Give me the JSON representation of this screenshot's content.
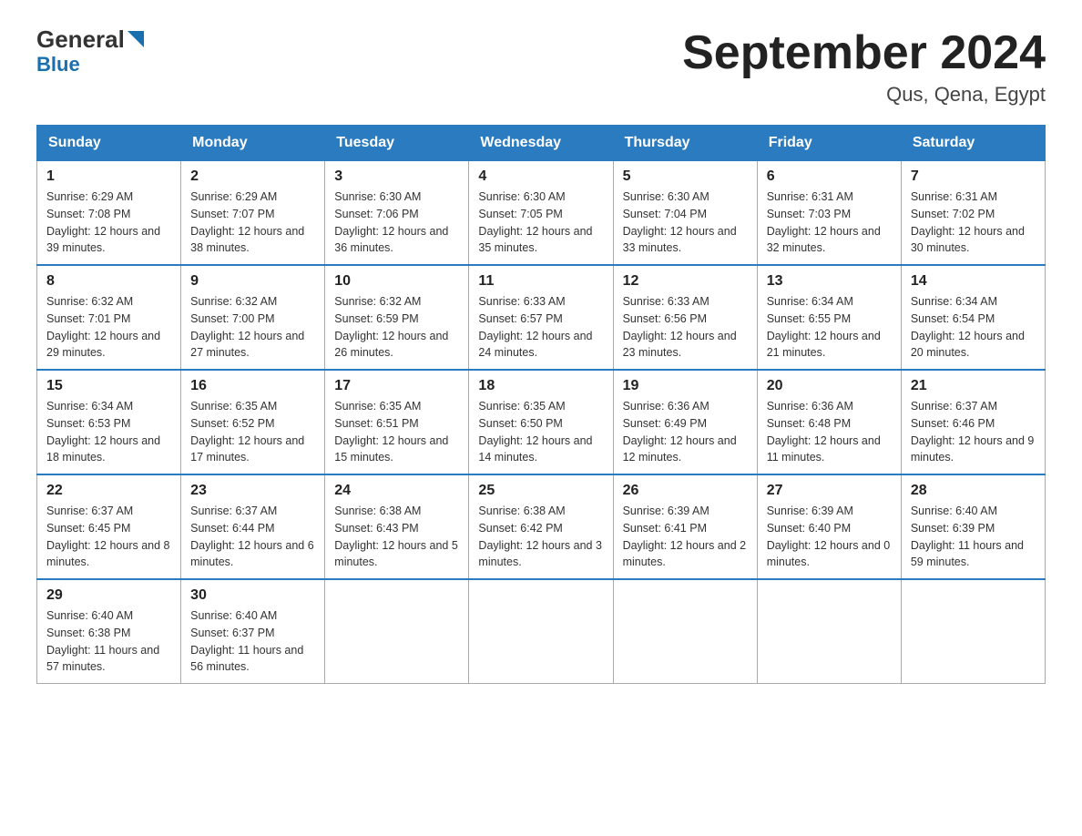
{
  "logo": {
    "text_general": "General",
    "text_blue": "Blue"
  },
  "title": "September 2024",
  "subtitle": "Qus, Qena, Egypt",
  "days_of_week": [
    "Sunday",
    "Monday",
    "Tuesday",
    "Wednesday",
    "Thursday",
    "Friday",
    "Saturday"
  ],
  "weeks": [
    [
      {
        "day": "1",
        "sunrise": "6:29 AM",
        "sunset": "7:08 PM",
        "daylight": "12 hours and 39 minutes."
      },
      {
        "day": "2",
        "sunrise": "6:29 AM",
        "sunset": "7:07 PM",
        "daylight": "12 hours and 38 minutes."
      },
      {
        "day": "3",
        "sunrise": "6:30 AM",
        "sunset": "7:06 PM",
        "daylight": "12 hours and 36 minutes."
      },
      {
        "day": "4",
        "sunrise": "6:30 AM",
        "sunset": "7:05 PM",
        "daylight": "12 hours and 35 minutes."
      },
      {
        "day": "5",
        "sunrise": "6:30 AM",
        "sunset": "7:04 PM",
        "daylight": "12 hours and 33 minutes."
      },
      {
        "day": "6",
        "sunrise": "6:31 AM",
        "sunset": "7:03 PM",
        "daylight": "12 hours and 32 minutes."
      },
      {
        "day": "7",
        "sunrise": "6:31 AM",
        "sunset": "7:02 PM",
        "daylight": "12 hours and 30 minutes."
      }
    ],
    [
      {
        "day": "8",
        "sunrise": "6:32 AM",
        "sunset": "7:01 PM",
        "daylight": "12 hours and 29 minutes."
      },
      {
        "day": "9",
        "sunrise": "6:32 AM",
        "sunset": "7:00 PM",
        "daylight": "12 hours and 27 minutes."
      },
      {
        "day": "10",
        "sunrise": "6:32 AM",
        "sunset": "6:59 PM",
        "daylight": "12 hours and 26 minutes."
      },
      {
        "day": "11",
        "sunrise": "6:33 AM",
        "sunset": "6:57 PM",
        "daylight": "12 hours and 24 minutes."
      },
      {
        "day": "12",
        "sunrise": "6:33 AM",
        "sunset": "6:56 PM",
        "daylight": "12 hours and 23 minutes."
      },
      {
        "day": "13",
        "sunrise": "6:34 AM",
        "sunset": "6:55 PM",
        "daylight": "12 hours and 21 minutes."
      },
      {
        "day": "14",
        "sunrise": "6:34 AM",
        "sunset": "6:54 PM",
        "daylight": "12 hours and 20 minutes."
      }
    ],
    [
      {
        "day": "15",
        "sunrise": "6:34 AM",
        "sunset": "6:53 PM",
        "daylight": "12 hours and 18 minutes."
      },
      {
        "day": "16",
        "sunrise": "6:35 AM",
        "sunset": "6:52 PM",
        "daylight": "12 hours and 17 minutes."
      },
      {
        "day": "17",
        "sunrise": "6:35 AM",
        "sunset": "6:51 PM",
        "daylight": "12 hours and 15 minutes."
      },
      {
        "day": "18",
        "sunrise": "6:35 AM",
        "sunset": "6:50 PM",
        "daylight": "12 hours and 14 minutes."
      },
      {
        "day": "19",
        "sunrise": "6:36 AM",
        "sunset": "6:49 PM",
        "daylight": "12 hours and 12 minutes."
      },
      {
        "day": "20",
        "sunrise": "6:36 AM",
        "sunset": "6:48 PM",
        "daylight": "12 hours and 11 minutes."
      },
      {
        "day": "21",
        "sunrise": "6:37 AM",
        "sunset": "6:46 PM",
        "daylight": "12 hours and 9 minutes."
      }
    ],
    [
      {
        "day": "22",
        "sunrise": "6:37 AM",
        "sunset": "6:45 PM",
        "daylight": "12 hours and 8 minutes."
      },
      {
        "day": "23",
        "sunrise": "6:37 AM",
        "sunset": "6:44 PM",
        "daylight": "12 hours and 6 minutes."
      },
      {
        "day": "24",
        "sunrise": "6:38 AM",
        "sunset": "6:43 PM",
        "daylight": "12 hours and 5 minutes."
      },
      {
        "day": "25",
        "sunrise": "6:38 AM",
        "sunset": "6:42 PM",
        "daylight": "12 hours and 3 minutes."
      },
      {
        "day": "26",
        "sunrise": "6:39 AM",
        "sunset": "6:41 PM",
        "daylight": "12 hours and 2 minutes."
      },
      {
        "day": "27",
        "sunrise": "6:39 AM",
        "sunset": "6:40 PM",
        "daylight": "12 hours and 0 minutes."
      },
      {
        "day": "28",
        "sunrise": "6:40 AM",
        "sunset": "6:39 PM",
        "daylight": "11 hours and 59 minutes."
      }
    ],
    [
      {
        "day": "29",
        "sunrise": "6:40 AM",
        "sunset": "6:38 PM",
        "daylight": "11 hours and 57 minutes."
      },
      {
        "day": "30",
        "sunrise": "6:40 AM",
        "sunset": "6:37 PM",
        "daylight": "11 hours and 56 minutes."
      },
      null,
      null,
      null,
      null,
      null
    ]
  ]
}
